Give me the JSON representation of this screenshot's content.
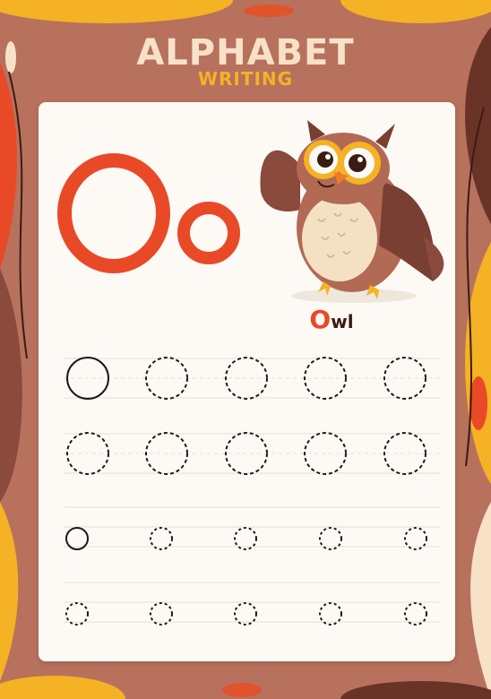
{
  "header": {
    "title": "ALPHABET",
    "subtitle": "WRITING"
  },
  "letter": {
    "upper": "O",
    "lower": "o"
  },
  "picture": {
    "subject_icon": "owl-icon",
    "word_first": "O",
    "word_rest": "wl"
  },
  "colors": {
    "background": "#b7715d",
    "accent_orange": "#e84a27",
    "accent_yellow": "#f4b224",
    "cream": "#f7e2c8",
    "sheet": "#fdfaf6"
  }
}
